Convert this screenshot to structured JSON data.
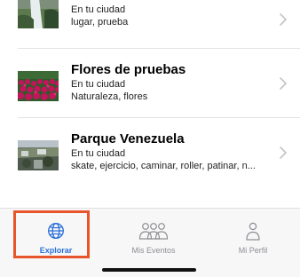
{
  "items": [
    {
      "title": "",
      "location": "En tu ciudad",
      "tags": "lugar, prueba",
      "image": "waterfall-photo"
    },
    {
      "title": "Flores de pruebas",
      "location": "En tu ciudad",
      "tags": "Naturaleza, flores",
      "image": "flowers-photo"
    },
    {
      "title": "Parque Venezuela",
      "location": "En tu ciudad",
      "tags": "skate, ejercicio, caminar, roller, patinar, n...",
      "image": "park-photo"
    }
  ],
  "tabbar": {
    "tabs": [
      {
        "label": "Explorar",
        "icon": "globe-icon",
        "active": true
      },
      {
        "label": "Mis Eventos",
        "icon": "people-icon",
        "active": false
      },
      {
        "label": "Mi Perfil",
        "icon": "person-icon",
        "active": false
      }
    ],
    "colors": {
      "active": "#2b6fd8",
      "inactive": "#8e8e93",
      "highlight": "#e8542c"
    }
  }
}
